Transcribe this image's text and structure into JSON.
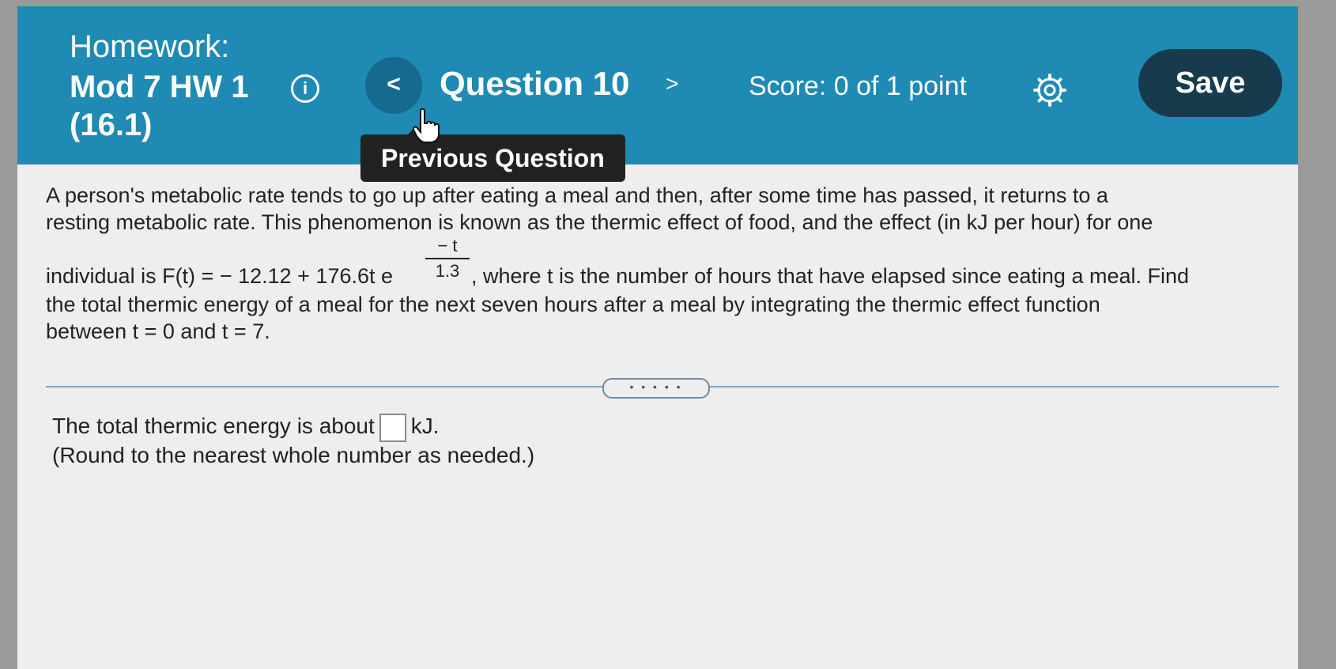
{
  "header": {
    "homework_label": "Homework:",
    "assignment_name_line1": "Mod 7 HW 1",
    "assignment_name_line2": "(16.1)",
    "info_icon_glyph": "i",
    "prev_glyph": "<",
    "question_title": "Question 10",
    "next_glyph": ">",
    "score": "Score: 0 of 1 point",
    "save_label": "Save",
    "background_color": "#1f8ab3",
    "save_color": "#173b4d"
  },
  "tooltip": {
    "text": "Previous Question"
  },
  "question": {
    "line1": "A person's metabolic rate tends to go up after eating a meal and then, after some time has passed, it returns to a",
    "line2": "resting metabolic rate. This phenomenon is known as the thermic effect of food, and the effect (in kJ per hour) for one",
    "formula_prefix": "individual is F(t) = − 12.12 + 176.6t e",
    "exp_numerator": "− t",
    "exp_denominator": "1.3",
    "formula_suffix": ", where t is the number of hours that have elapsed since eating a meal. Find",
    "line4": "the total thermic energy of a meal for the next seven hours after a meal by integrating the thermic effect function",
    "line5": "between t = 0 and t = 7."
  },
  "divider_handle": "• • • • •",
  "answer": {
    "prefix": "The total thermic energy is about",
    "input_value": "",
    "suffix": "kJ.",
    "note": "(Round to the nearest whole number as needed.)"
  },
  "icons": {
    "info": "info-icon",
    "settings": "gear-icon",
    "cursor": "hand-pointer-icon"
  }
}
